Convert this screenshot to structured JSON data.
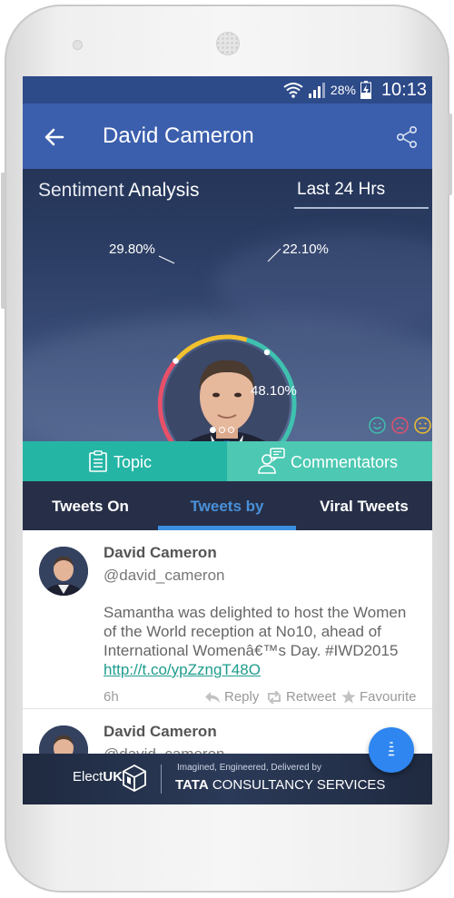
{
  "status_bar": {
    "battery": "28%",
    "time": "10:13"
  },
  "app_bar": {
    "title": "David Cameron"
  },
  "sentiment": {
    "label_light": "Sentiment",
    "label_bold": "Analysis",
    "range": "Last 24 Hrs",
    "percent_positive": "22.10%",
    "percent_neutral": "29.80%",
    "percent_negative": "48.10%",
    "colors": {
      "positive": "#3fc1b0",
      "neutral": "#f2c12e",
      "negative": "#e8506a"
    }
  },
  "tabs_primary": {
    "topic": "Topic",
    "commentators": "Commentators"
  },
  "tabs_secondary": {
    "tweets_on": "Tweets On",
    "tweets_by": "Tweets by",
    "viral": "Viral Tweets"
  },
  "tweets": [
    {
      "name": "David Cameron",
      "handle": "@david_cameron",
      "text": "Samantha was delighted to host the Women of the World reception at No10, ahead of International Womenâ€™s Day. #IWD2015",
      "link": "http://t.co/ypZzngT48O",
      "time": "6h",
      "reply": "Reply",
      "retweet": "Retweet",
      "favourite": "Favourite"
    },
    {
      "name": "David Cameron",
      "handle": "@david_cameron"
    }
  ],
  "footer": {
    "brand": "Elect",
    "brand_bold": "UK",
    "tagline": "Imagined, Engineered, Delivered by",
    "company_bold": "TATA",
    "company_rest": "CONSULTANCY SERVICES"
  },
  "colors": {
    "app_bar": "#3b5fad",
    "status_bar": "#2d4a89",
    "accent_teal": "#25b5a5",
    "selected_tab": "#4a90d9",
    "fab": "#2f86f0"
  }
}
